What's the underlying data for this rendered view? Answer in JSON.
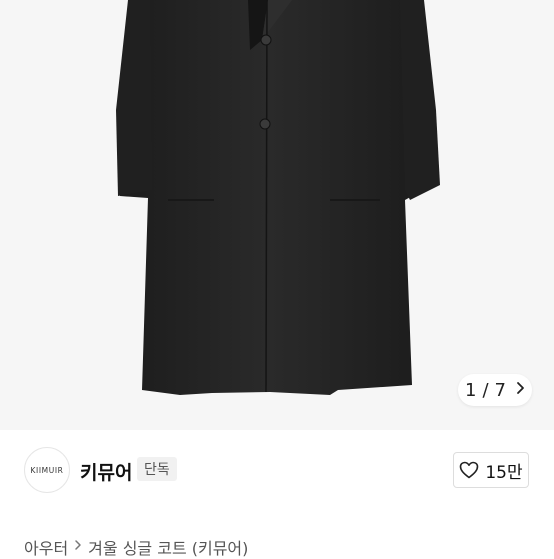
{
  "gallery": {
    "image_alt": "black single-breasted winter coat",
    "pager": {
      "current": "1",
      "separator": "/",
      "total": "7"
    }
  },
  "brand": {
    "logo_text": "KIIMUIR",
    "name": "키뮤어",
    "badge": "단독"
  },
  "like": {
    "count": "15만"
  },
  "breadcrumb": {
    "category": "아우터",
    "product": "겨울 싱글 코트 (키뮤어)"
  },
  "colors": {
    "hero_bg": "#f6f6f6",
    "coat": "#262626",
    "badge_bg": "#f1f1f1"
  },
  "icons": [
    "chevron-right-icon",
    "heart-outline-icon"
  ]
}
